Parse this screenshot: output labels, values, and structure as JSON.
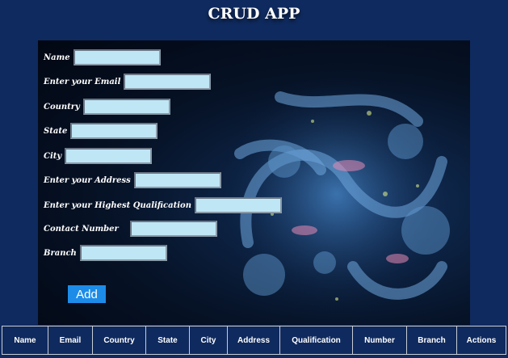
{
  "header": {
    "title": "CRUD APP"
  },
  "form": {
    "fields": [
      {
        "label": "Name"
      },
      {
        "label": "Enter your Email"
      },
      {
        "label": "Country"
      },
      {
        "label": "State"
      },
      {
        "label": "City"
      },
      {
        "label": "Enter your Address"
      },
      {
        "label": "Enter your Highest Qualification"
      },
      {
        "label": "Contact Number"
      },
      {
        "label": "Branch"
      }
    ],
    "add_label": "Add"
  },
  "table": {
    "columns": [
      "Name",
      "Email",
      "Country",
      "State",
      "City",
      "Address",
      "Qualification",
      "Number",
      "Branch",
      "Actions"
    ]
  },
  "colors": {
    "background": "#0f2a5e",
    "input_fill": "#bfe6f5",
    "add_button": "#1d8ce8"
  }
}
